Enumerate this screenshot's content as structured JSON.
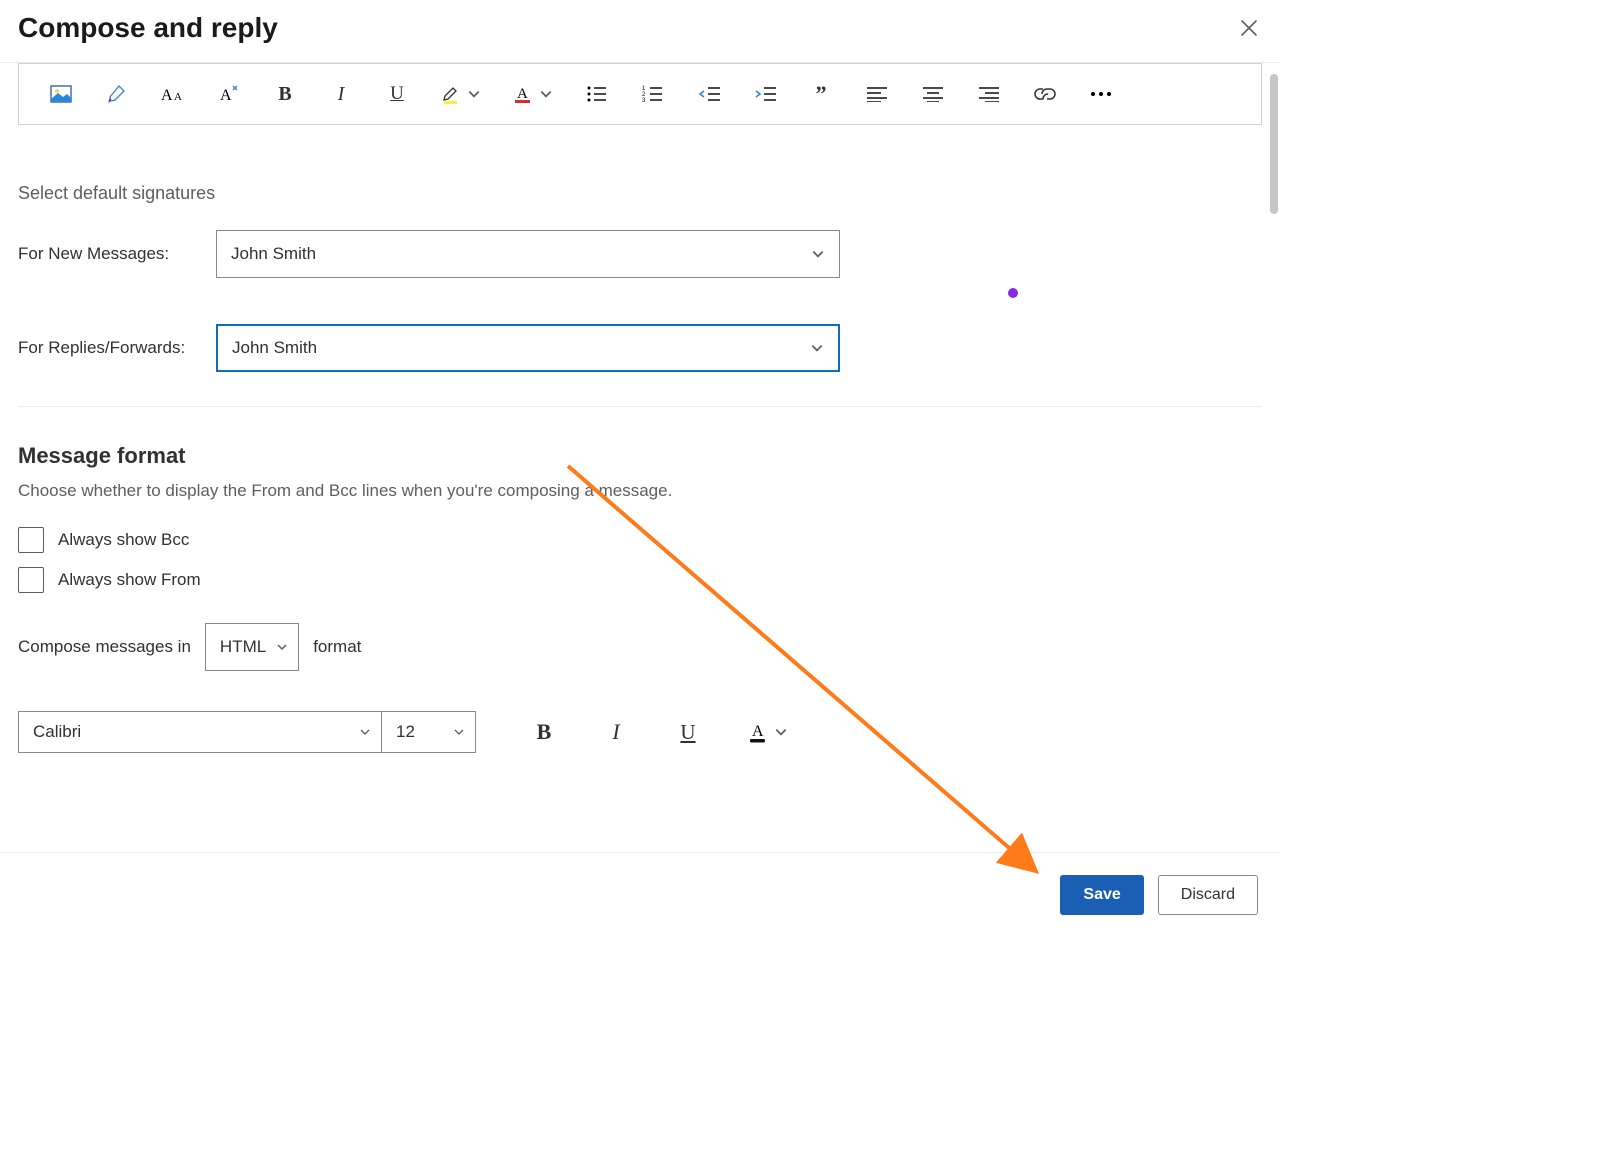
{
  "header": {
    "title": "Compose and reply"
  },
  "signatures": {
    "subhead": "Select default signatures",
    "new_label": "For New Messages:",
    "new_value": "John Smith",
    "reply_label": "For Replies/Forwards:",
    "reply_value": "John Smith"
  },
  "format": {
    "head": "Message format",
    "desc": "Choose whether to display the From and Bcc lines when you're composing a message.",
    "bcc_label": "Always show Bcc",
    "from_label": "Always show From",
    "compose_pre": "Compose messages in",
    "compose_value": "HTML",
    "compose_post": "format",
    "font_name": "Calibri",
    "font_size": "12"
  },
  "footer": {
    "save": "Save",
    "discard": "Discard"
  }
}
